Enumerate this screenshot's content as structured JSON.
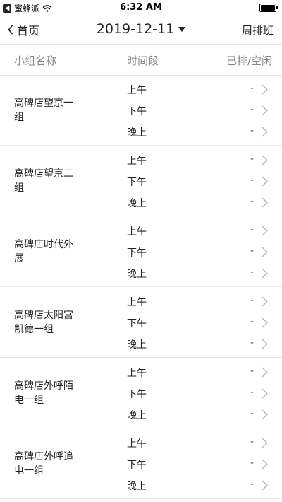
{
  "status_bar": {
    "back_app_badge": "◀",
    "carrier": "蜜蜂派",
    "time": "6:32 AM",
    "battery_level": 1.0
  },
  "nav": {
    "back_label": "首页",
    "date": "2019-12-11",
    "right_label": "周排班"
  },
  "table_header": {
    "group_name": "小组名称",
    "time_slot": "时间段",
    "status": "已排/空闲"
  },
  "groups": [
    {
      "name": "高碑店望京一组",
      "slots": [
        {
          "label": "上午",
          "value": "-"
        },
        {
          "label": "下午",
          "value": "-"
        },
        {
          "label": "晚上",
          "value": "-"
        }
      ]
    },
    {
      "name": "高碑店望京二组",
      "slots": [
        {
          "label": "上午",
          "value": "-"
        },
        {
          "label": "下午",
          "value": "-"
        },
        {
          "label": "晚上",
          "value": "-"
        }
      ]
    },
    {
      "name": "高碑店时代外展",
      "slots": [
        {
          "label": "上午",
          "value": "-"
        },
        {
          "label": "下午",
          "value": "-"
        },
        {
          "label": "晚上",
          "value": "-"
        }
      ]
    },
    {
      "name": "高碑店太阳宫凯德一组",
      "slots": [
        {
          "label": "上午",
          "value": "-"
        },
        {
          "label": "下午",
          "value": "-"
        },
        {
          "label": "晚上",
          "value": "-"
        }
      ]
    },
    {
      "name": "高碑店外呼陌电一组",
      "slots": [
        {
          "label": "上午",
          "value": "-"
        },
        {
          "label": "下午",
          "value": "-"
        },
        {
          "label": "晚上",
          "value": "-"
        }
      ]
    },
    {
      "name": "高碑店外呼追电一组",
      "slots": [
        {
          "label": "上午",
          "value": "-"
        },
        {
          "label": "下午",
          "value": "-"
        },
        {
          "label": "晚上",
          "value": "-"
        }
      ]
    }
  ]
}
